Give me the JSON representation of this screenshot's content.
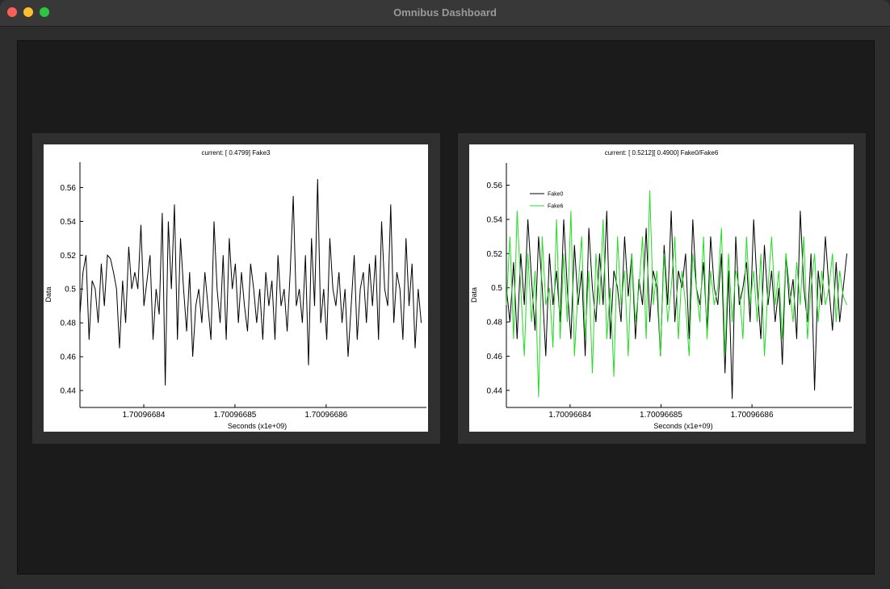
{
  "window": {
    "title": "Omnibus Dashboard"
  },
  "colors": {
    "series_black": "#000000",
    "series_green": "#22dd22"
  },
  "chart_data": [
    {
      "type": "line",
      "title": "current: [ 0.4799] Fake3",
      "xlabel": "Seconds (x1e+09)",
      "ylabel": "Data",
      "xlim": [
        1.700966833,
        1.700966871
      ],
      "ylim": [
        0.43,
        0.575
      ],
      "xticks": [
        1.70096684,
        1.70096685,
        1.70096686
      ],
      "xtick_labels": [
        "1.70096684",
        "1.70096685",
        "1.70096686"
      ],
      "yticks": [
        0.44,
        0.46,
        0.48,
        0.5,
        0.52,
        0.54,
        0.56
      ],
      "ytick_labels": [
        "0.44",
        "0.46",
        "0.48",
        "0.5",
        "0.52",
        "0.54",
        "0.56"
      ],
      "legend": "none",
      "series": [
        {
          "color": "#000000",
          "values": [
            0.485,
            0.51,
            0.52,
            0.47,
            0.505,
            0.5,
            0.48,
            0.515,
            0.49,
            0.52,
            0.518,
            0.51,
            0.5,
            0.465,
            0.505,
            0.48,
            0.525,
            0.5,
            0.51,
            0.5,
            0.538,
            0.49,
            0.505,
            0.52,
            0.47,
            0.5,
            0.485,
            0.545,
            0.443,
            0.54,
            0.5,
            0.55,
            0.47,
            0.53,
            0.5,
            0.475,
            0.51,
            0.46,
            0.49,
            0.5,
            0.48,
            0.51,
            0.49,
            0.47,
            0.54,
            0.5,
            0.48,
            0.52,
            0.47,
            0.53,
            0.5,
            0.515,
            0.48,
            0.51,
            0.49,
            0.475,
            0.515,
            0.5,
            0.48,
            0.5,
            0.47,
            0.51,
            0.49,
            0.505,
            0.47,
            0.52,
            0.49,
            0.5,
            0.475,
            0.51,
            0.555,
            0.49,
            0.5,
            0.48,
            0.52,
            0.455,
            0.53,
            0.49,
            0.565,
            0.48,
            0.5,
            0.47,
            0.53,
            0.5,
            0.49,
            0.51,
            0.48,
            0.5,
            0.46,
            0.49,
            0.52,
            0.47,
            0.5,
            0.51,
            0.48,
            0.515,
            0.49,
            0.52,
            0.47,
            0.54,
            0.5,
            0.49,
            0.55,
            0.48,
            0.51,
            0.5,
            0.47,
            0.53,
            0.49,
            0.515,
            0.465,
            0.5,
            0.48
          ]
        }
      ]
    },
    {
      "type": "line",
      "title": "current: [ 0.5212][ 0.4900] Fake0/Fake6",
      "xlabel": "Seconds (x1e+09)",
      "ylabel": "Data",
      "xlim": [
        1.700966833,
        1.700966871
      ],
      "ylim": [
        0.43,
        0.573
      ],
      "xticks": [
        1.70096684,
        1.70096685,
        1.70096686
      ],
      "xtick_labels": [
        "1.70096684",
        "1.70096685",
        "1.70096686"
      ],
      "yticks": [
        0.44,
        0.46,
        0.48,
        0.5,
        0.52,
        0.54,
        0.56
      ],
      "ytick_labels": [
        "0.44",
        "0.46",
        "0.48",
        "0.5",
        "0.52",
        "0.54",
        "0.56"
      ],
      "legend": "top-left",
      "series": [
        {
          "name": "Fake0",
          "color": "#000000",
          "values": [
            0.5,
            0.48,
            0.515,
            0.47,
            0.52,
            0.49,
            0.54,
            0.505,
            0.475,
            0.53,
            0.5,
            0.46,
            0.52,
            0.49,
            0.51,
            0.48,
            0.54,
            0.5,
            0.47,
            0.525,
            0.49,
            0.51,
            0.46,
            0.535,
            0.5,
            0.48,
            0.52,
            0.49,
            0.545,
            0.47,
            0.51,
            0.5,
            0.48,
            0.53,
            0.495,
            0.52,
            0.47,
            0.505,
            0.49,
            0.535,
            0.48,
            0.51,
            0.5,
            0.46,
            0.525,
            0.49,
            0.545,
            0.48,
            0.51,
            0.5,
            0.52,
            0.47,
            0.54,
            0.5,
            0.49,
            0.515,
            0.475,
            0.53,
            0.5,
            0.49,
            0.52,
            0.45,
            0.51,
            0.435,
            0.53,
            0.49,
            0.5,
            0.515,
            0.48,
            0.54,
            0.5,
            0.47,
            0.525,
            0.49,
            0.51,
            0.48,
            0.5,
            0.455,
            0.52,
            0.49,
            0.505,
            0.47,
            0.545,
            0.5,
            0.48,
            0.52,
            0.44,
            0.51,
            0.49,
            0.53,
            0.5,
            0.475,
            0.515,
            0.48,
            0.5,
            0.52
          ]
        },
        {
          "name": "Fake6",
          "color": "#22dd22",
          "values": [
            0.49,
            0.53,
            0.47,
            0.545,
            0.5,
            0.46,
            0.52,
            0.48,
            0.51,
            0.436,
            0.53,
            0.49,
            0.5,
            0.465,
            0.54,
            0.47,
            0.52,
            0.48,
            0.545,
            0.46,
            0.5,
            0.53,
            0.47,
            0.51,
            0.45,
            0.52,
            0.49,
            0.54,
            0.47,
            0.5,
            0.448,
            0.53,
            0.49,
            0.51,
            0.46,
            0.52,
            0.48,
            0.5,
            0.53,
            0.47,
            0.557,
            0.49,
            0.51,
            0.46,
            0.52,
            0.48,
            0.5,
            0.53,
            0.47,
            0.51,
            0.49,
            0.46,
            0.52,
            0.5,
            0.48,
            0.53,
            0.47,
            0.51,
            0.49,
            0.5,
            0.535,
            0.46,
            0.52,
            0.48,
            0.51,
            0.5,
            0.47,
            0.53,
            0.49,
            0.51,
            0.48,
            0.52,
            0.46,
            0.5,
            0.53,
            0.49,
            0.51,
            0.47,
            0.52,
            0.5,
            0.48,
            0.515,
            0.49,
            0.53,
            0.47,
            0.5,
            0.52,
            0.48,
            0.51,
            0.49,
            0.5,
            0.52,
            0.48,
            0.51,
            0.495,
            0.49
          ]
        }
      ]
    }
  ]
}
